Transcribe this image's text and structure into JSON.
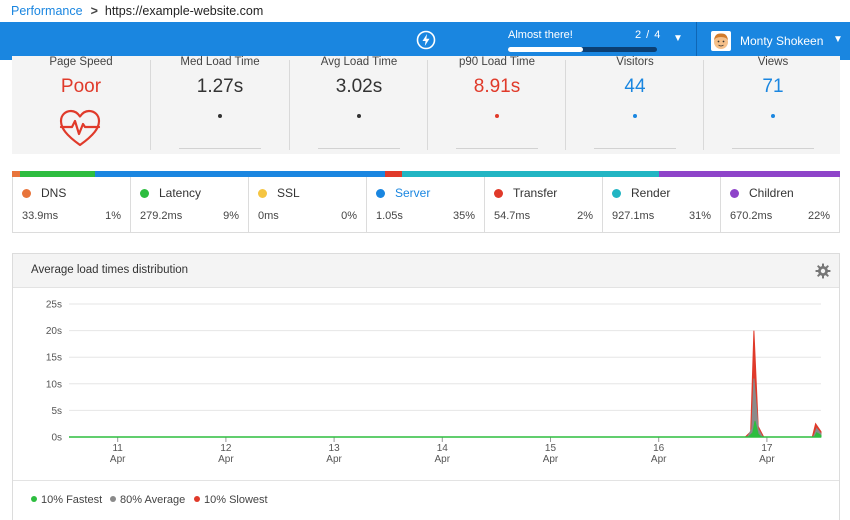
{
  "breadcrumb": {
    "root": "Performance",
    "separator": ">",
    "url": "https://example-website.com"
  },
  "topbar": {
    "icon": "bolt-icon",
    "progress": {
      "label": "Almost there!",
      "count": "2 / 4",
      "fraction": 0.5
    },
    "user": {
      "name": "Monty Shokeen"
    }
  },
  "metrics": [
    {
      "label": "Page Speed",
      "value": "Poor",
      "color": "#e03a2a",
      "icon": "heart-pulse-icon"
    },
    {
      "label": "Med Load Time",
      "value": "1.27s",
      "color": "#333333",
      "dot": "#333333"
    },
    {
      "label": "Avg Load Time",
      "value": "3.02s",
      "color": "#333333",
      "dot": "#333333"
    },
    {
      "label": "p90 Load Time",
      "value": "8.91s",
      "color": "#e03a2a",
      "dot": "#e03a2a"
    },
    {
      "label": "Visitors",
      "value": "44",
      "color": "#1a86e0",
      "dot": "#1a86e0"
    },
    {
      "label": "Views",
      "value": "71",
      "color": "#1a86e0",
      "dot": "#1a86e0"
    }
  ],
  "strip": [
    {
      "color": "#e8743b",
      "fraction": 0.01
    },
    {
      "color": "#2dbd3f",
      "fraction": 0.09
    },
    {
      "color": "#1a86e0",
      "fraction": 0.35
    },
    {
      "color": "#e03a2a",
      "fraction": 0.02
    },
    {
      "color": "#22b5c3",
      "fraction": 0.31
    },
    {
      "color": "#8e44c9",
      "fraction": 0.22
    }
  ],
  "phases": [
    {
      "name": "DNS",
      "time": "33.9ms",
      "pct": "1%",
      "color": "#e8743b"
    },
    {
      "name": "Latency",
      "time": "279.2ms",
      "pct": "9%",
      "color": "#2dbd3f"
    },
    {
      "name": "SSL",
      "time": "0ms",
      "pct": "0%",
      "color": "#f5c542"
    },
    {
      "name": "Server",
      "time": "1.05s",
      "pct": "35%",
      "color": "#1a86e0",
      "highlight": true
    },
    {
      "name": "Transfer",
      "time": "54.7ms",
      "pct": "2%",
      "color": "#e03a2a"
    },
    {
      "name": "Render",
      "time": "927.1ms",
      "pct": "31%",
      "color": "#22b5c3"
    },
    {
      "name": "Children",
      "time": "670.2ms",
      "pct": "22%",
      "color": "#8e44c9"
    }
  ],
  "panel": {
    "title": "Average load times distribution",
    "settings_icon": "gear-icon"
  },
  "chart_data": {
    "type": "area",
    "y_ticks": [
      "25s",
      "20s",
      "15s",
      "10s",
      "5s",
      "0s"
    ],
    "ylim": [
      0,
      25
    ],
    "x_ticks": [
      {
        "day": "11",
        "month": "Apr"
      },
      {
        "day": "12",
        "month": "Apr"
      },
      {
        "day": "13",
        "month": "Apr"
      },
      {
        "day": "14",
        "month": "Apr"
      },
      {
        "day": "15",
        "month": "Apr"
      },
      {
        "day": "16",
        "month": "Apr"
      },
      {
        "day": "17",
        "month": "Apr"
      }
    ],
    "xlim": [
      10.55,
      17.5
    ],
    "grid": true,
    "legend_position": "bottom-left",
    "series": [
      {
        "name": "10% Slowest",
        "color": "#e03a2a",
        "points": [
          [
            10.55,
            0
          ],
          [
            16.8,
            0
          ],
          [
            16.85,
            1
          ],
          [
            16.88,
            20
          ],
          [
            16.92,
            2
          ],
          [
            16.97,
            0
          ],
          [
            17.42,
            0
          ],
          [
            17.45,
            2.5
          ],
          [
            17.5,
            1
          ]
        ]
      },
      {
        "name": "80% Average",
        "color": "#8a8a8a",
        "points": [
          [
            10.55,
            0
          ],
          [
            16.82,
            0
          ],
          [
            16.86,
            1.5
          ],
          [
            16.88,
            11
          ],
          [
            16.92,
            1.5
          ],
          [
            16.96,
            0
          ],
          [
            17.43,
            0
          ],
          [
            17.46,
            1.6
          ],
          [
            17.5,
            0.6
          ]
        ]
      },
      {
        "name": "10% Fastest",
        "color": "#2dbd3f",
        "points": [
          [
            10.55,
            0
          ],
          [
            16.83,
            0
          ],
          [
            16.87,
            0.8
          ],
          [
            16.89,
            3
          ],
          [
            16.92,
            0.5
          ],
          [
            16.95,
            0
          ],
          [
            17.44,
            0
          ],
          [
            17.46,
            0.8
          ],
          [
            17.5,
            0.3
          ]
        ]
      }
    ]
  }
}
